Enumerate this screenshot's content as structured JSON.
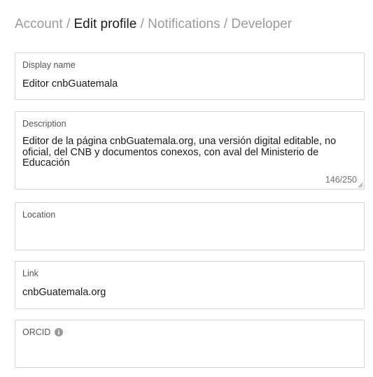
{
  "breadcrumb": {
    "items": [
      {
        "label": "Account"
      },
      {
        "label": "Edit profile"
      },
      {
        "label": "Notifications"
      },
      {
        "label": "Developer"
      }
    ],
    "separator": "/"
  },
  "form": {
    "display_name": {
      "label": "Display name",
      "value": "Editor cnbGuatemala"
    },
    "description": {
      "label": "Description",
      "value": "Editor de la página cnbGuatemala.org, una versión digital editable, no oficial, del CNB y documentos conexos, con aval del Ministerio de Educación",
      "counter": "146/250"
    },
    "location": {
      "label": "Location",
      "value": ""
    },
    "link": {
      "label": "Link",
      "value": "cnbGuatemala.org"
    },
    "orcid": {
      "label": "ORCID",
      "value": "",
      "icon": "info-icon"
    }
  },
  "colors": {
    "active_text": "#1a1a1a",
    "muted_text": "#9b9b9b",
    "border": "#d4d4d4"
  }
}
